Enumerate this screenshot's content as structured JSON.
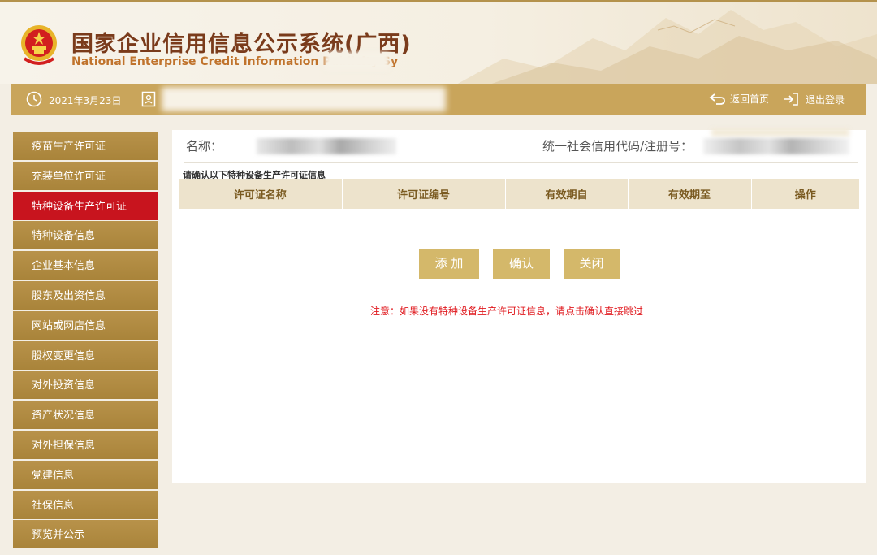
{
  "header": {
    "title_cn": "国家企业信用信息公示系统(广西)",
    "title_en": "National Enterprise Credit Information Publicity Sy"
  },
  "topbar": {
    "date": "2021年3月23日",
    "home_label": "返回首页",
    "logout_label": "退出登录"
  },
  "sidebar": {
    "items": [
      {
        "label": "疫苗生产许可证"
      },
      {
        "label": "充装单位许可证"
      },
      {
        "label": "特种设备生产许可证"
      },
      {
        "label": "特种设备信息"
      },
      {
        "label": "企业基本信息"
      },
      {
        "label": "股东及出资信息"
      },
      {
        "label": "网站或网店信息"
      },
      {
        "label": "股权变更信息"
      },
      {
        "label": "对外投资信息"
      },
      {
        "label": "资产状况信息"
      },
      {
        "label": "对外担保信息"
      },
      {
        "label": "党建信息"
      },
      {
        "label": "社保信息"
      },
      {
        "label": "预览并公示"
      }
    ],
    "active_index": 2
  },
  "main": {
    "name_label": "名称：",
    "code_label": "统一社会信用代码/注册号：",
    "section_title": "请确认以下特种设备生产许可证信息",
    "table": {
      "headers": [
        "许可证名称",
        "许可证编号",
        "有效期自",
        "有效期至",
        "操作"
      ]
    },
    "buttons": {
      "add": "添 加",
      "confirm": "确认",
      "close": "关闭"
    },
    "notice": "注意：如果没有特种设备生产许可证信息，请点击确认直接跳过"
  },
  "colors": {
    "gold": "#c9a55b",
    "nav_gold": "#b08a3e",
    "active_red": "#c8141e",
    "notice_red": "#e0191e",
    "title_brown": "#7a3b1b"
  }
}
